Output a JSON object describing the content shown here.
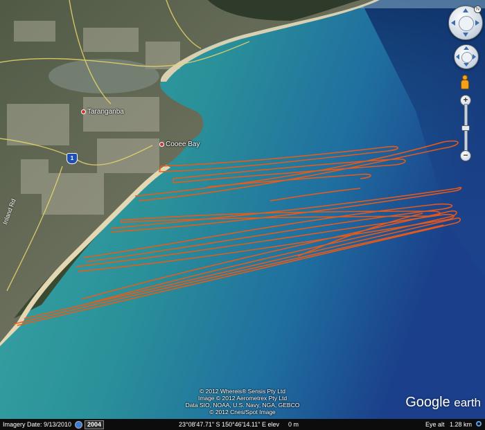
{
  "app": {
    "name": "Google Earth"
  },
  "map": {
    "places": [
      {
        "name": "Taranganba"
      },
      {
        "name": "Cooee Bay"
      }
    ],
    "road_shield": "1",
    "road_label": "Inland Rd",
    "track_color": "#f05a14",
    "water_color": "#2a9aa3",
    "deep_water_color": "#1d4c93",
    "land_color": "#55604a"
  },
  "credits": [
    "© 2012 Whereis® Sensis Pty Ltd",
    "Image © 2012 Aerometrex Pty Ltd",
    "Data SIO, NOAA, U.S. Navy, NGA, GEBCO",
    "© 2012 Cnes/Spot Image"
  ],
  "logo": {
    "google": "Google",
    "earth": "earth"
  },
  "controls": {
    "north_label": "N",
    "zoom_in": "+",
    "zoom_out": "−"
  },
  "statusbar": {
    "imagery_date": "Imagery Date: 9/13/2010",
    "historical_year": "2004",
    "coordinates": "23°08'47.71\" S 150°46'14.11\" E elev",
    "elevation": "0 m",
    "eye_alt_label": "Eye alt",
    "eye_alt_value": "1.28 km"
  }
}
